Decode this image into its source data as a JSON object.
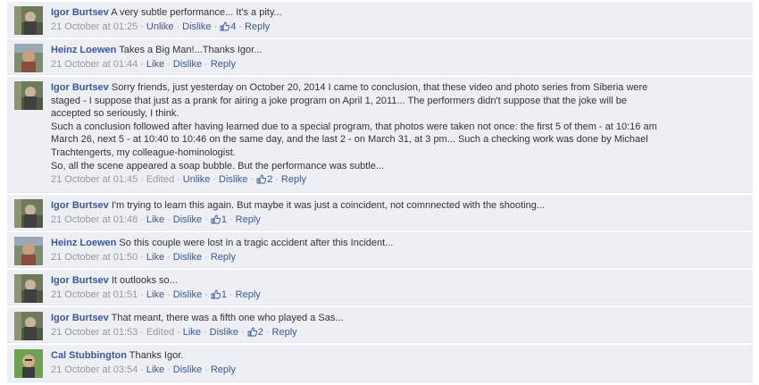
{
  "colors": {
    "background": "#edeff4",
    "link": "#3b5998",
    "meta": "#999999",
    "text": "#333333"
  },
  "comments": [
    {
      "author": "Igor Burtsev",
      "lines": [
        "A very subtle performance... It's a pity..."
      ],
      "time": "21 October at 01:25",
      "edited": "",
      "actions": [
        "Unlike",
        "Dislike"
      ],
      "likes": "4",
      "reply": "Reply",
      "avatar_icon": "igor-avatar-icon"
    },
    {
      "author": "Heinz Loewen",
      "lines": [
        "Takes a Big Man!...Thanks Igor..."
      ],
      "time": "21 October at 01:44",
      "edited": "",
      "actions": [
        "Like",
        "Dislike"
      ],
      "likes": "",
      "reply": "Reply",
      "avatar_icon": "heinz-avatar-icon"
    },
    {
      "author": "Igor Burtsev",
      "lines": [
        "Sorry friends, just yesterday on October 20, 2014 I came to conclusion, that these video and photo series from Siberia were",
        "staged - I suppose that just as a prank for airing a joke program on April 1, 2011... The performers didn't suppose that the joke will be",
        "accepted so seriously, I think.",
        "Such a conclusion followed after having learned due to a special program, that photos were taken not once: the first 5 of them - at 10:16 am",
        "March 26, next 5 - at 10:40 to 10:46 on the same day, and the last 2 - on March 31, at 3 pm... Such a checking work was done by Michael",
        "Trachtengerts, my colleague-hominologist.",
        "So, all the scene appeared a soap bubble. But the performance was subtle..."
      ],
      "time": "21 October at 01:45",
      "edited": "Edited",
      "actions": [
        "Unlike",
        "Dislike"
      ],
      "likes": "2",
      "reply": "Reply",
      "avatar_icon": "igor-avatar-icon"
    },
    {
      "author": "Igor Burtsev",
      "lines": [
        "I'm trying to learn this again. But maybe it was just a coincident, not comnnected with the shooting..."
      ],
      "time": "21 October at 01:48",
      "edited": "",
      "actions": [
        "Like",
        "Dislike"
      ],
      "likes": "1",
      "reply": "Reply",
      "avatar_icon": "igor-avatar-icon"
    },
    {
      "author": "Heinz Loewen",
      "lines": [
        "So this couple were lost in a tragic accident after this Incident..."
      ],
      "time": "21 October at 01:50",
      "edited": "",
      "actions": [
        "Like",
        "Dislike"
      ],
      "likes": "",
      "reply": "Reply",
      "avatar_icon": "heinz-avatar-icon"
    },
    {
      "author": "Igor Burtsev",
      "lines": [
        "It outlooks so..."
      ],
      "time": "21 October at 01:51",
      "edited": "",
      "actions": [
        "Like",
        "Dislike"
      ],
      "likes": "1",
      "reply": "Reply",
      "avatar_icon": "igor-avatar-icon"
    },
    {
      "author": "Igor Burtsev",
      "lines": [
        "That meant, there was a fifth one who played a Sas..."
      ],
      "time": "21 October at 01:53",
      "edited": "Edited",
      "actions": [
        "Like",
        "Dislike"
      ],
      "likes": "2",
      "reply": "Reply",
      "avatar_icon": "igor-avatar-icon"
    },
    {
      "author": "Cal Stubbington",
      "lines": [
        "Thanks Igor."
      ],
      "time": "21 October at 03:54",
      "edited": "",
      "actions": [
        "Like",
        "Dislike"
      ],
      "likes": "",
      "reply": "Reply",
      "avatar_icon": "cal-avatar-icon"
    }
  ]
}
